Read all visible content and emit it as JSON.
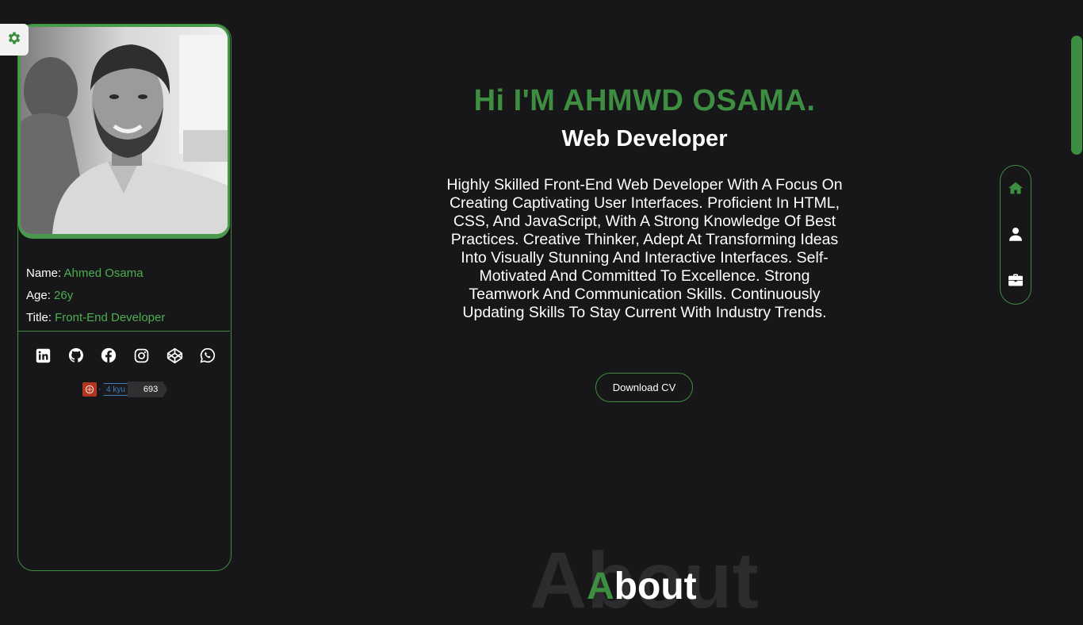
{
  "colors": {
    "accent": "#3e8e41",
    "background": "#171618",
    "text": "#ffffff"
  },
  "settings": {
    "icon": "gear-icon"
  },
  "profile": {
    "photo_alt": "",
    "info": [
      {
        "key": "Name",
        "value": "Ahmed Osama"
      },
      {
        "key": "Age",
        "value": "26y"
      },
      {
        "key": "Title",
        "value": "Front-End Developer"
      }
    ],
    "socials": [
      {
        "name": "linkedin-icon"
      },
      {
        "name": "github-icon"
      },
      {
        "name": "facebook-icon"
      },
      {
        "name": "instagram-icon"
      },
      {
        "name": "codepen-icon"
      },
      {
        "name": "whatsapp-icon"
      }
    ],
    "codewars": {
      "rank": "4 kyu",
      "score": "693"
    }
  },
  "hero": {
    "title": "Hi I'M AHMWD OSAMA.",
    "subtitle": "Web Developer",
    "description": "Highly Skilled Front-End Web Developer With A Focus On Creating Captivating User Interfaces. Proficient In HTML, CSS, And JavaScript, With A Strong Knowledge Of Best Practices. Creative Thinker, Adept At Transforming Ideas Into Visually Stunning And Interactive Interfaces. Self-Motivated And Committed To Excellence. Strong Teamwork And Communication Skills. Continuously Updating Skills To Stay Current With Industry Trends.",
    "download_label": "Download CV"
  },
  "nav": [
    {
      "name": "home-icon"
    },
    {
      "name": "user-icon"
    },
    {
      "name": "briefcase-icon"
    }
  ],
  "about": {
    "background_word": "About",
    "first_letter": "A",
    "rest": "bout"
  }
}
